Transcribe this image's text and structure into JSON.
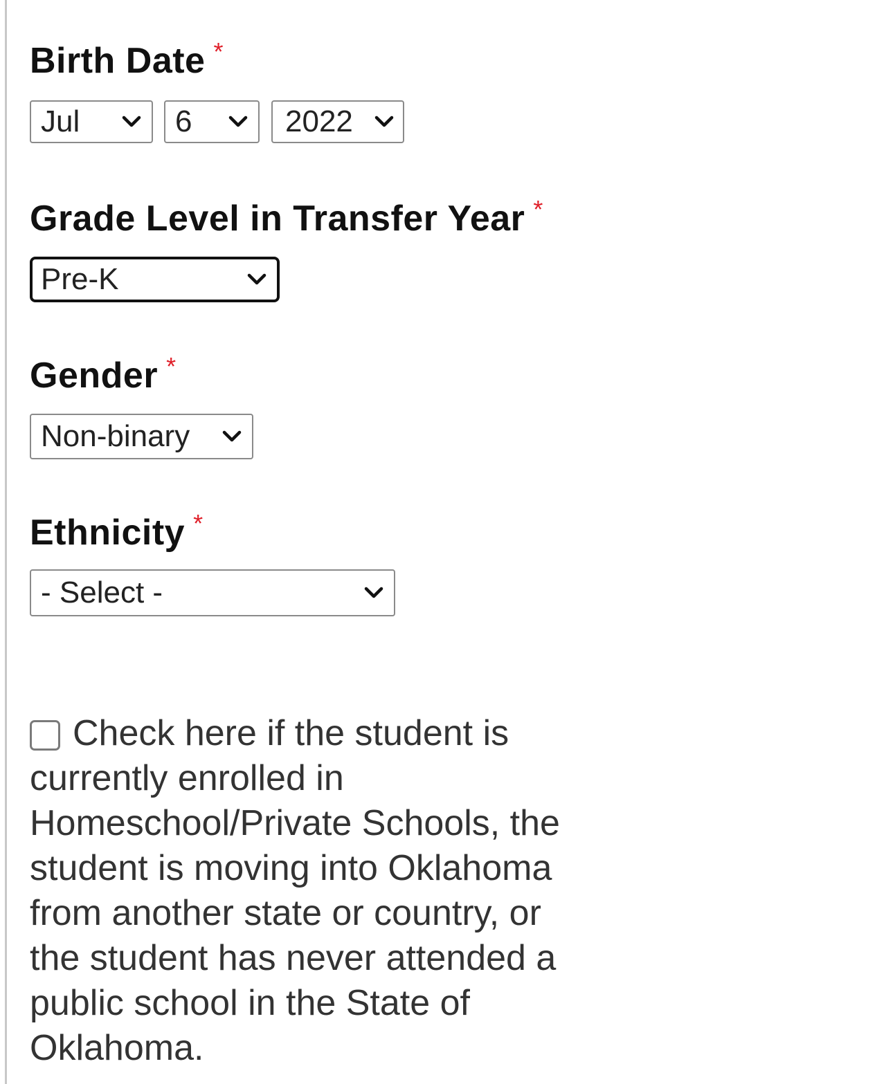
{
  "form": {
    "birth_date": {
      "label": "Birth Date",
      "required_marker": "*",
      "month": "Jul",
      "day": "6",
      "year": "2022"
    },
    "grade_level": {
      "label": "Grade Level in Transfer Year",
      "required_marker": "*",
      "value": "Pre-K"
    },
    "gender": {
      "label": "Gender",
      "required_marker": "*",
      "value": "Non-binary"
    },
    "ethnicity": {
      "label": "Ethnicity",
      "required_marker": "*",
      "value": "- Select -"
    },
    "enrollment_checkbox": {
      "checked": false,
      "label": "Check here if the student is currently enrolled in Homeschool/Private Schools, the student is moving into Oklahoma from another state or country, or the student has never attended a public school in the State of Oklahoma."
    }
  },
  "colors": {
    "required": "#e0202a",
    "label_text": "#111111",
    "body_text": "#333333",
    "border": "#8a8a8a"
  }
}
